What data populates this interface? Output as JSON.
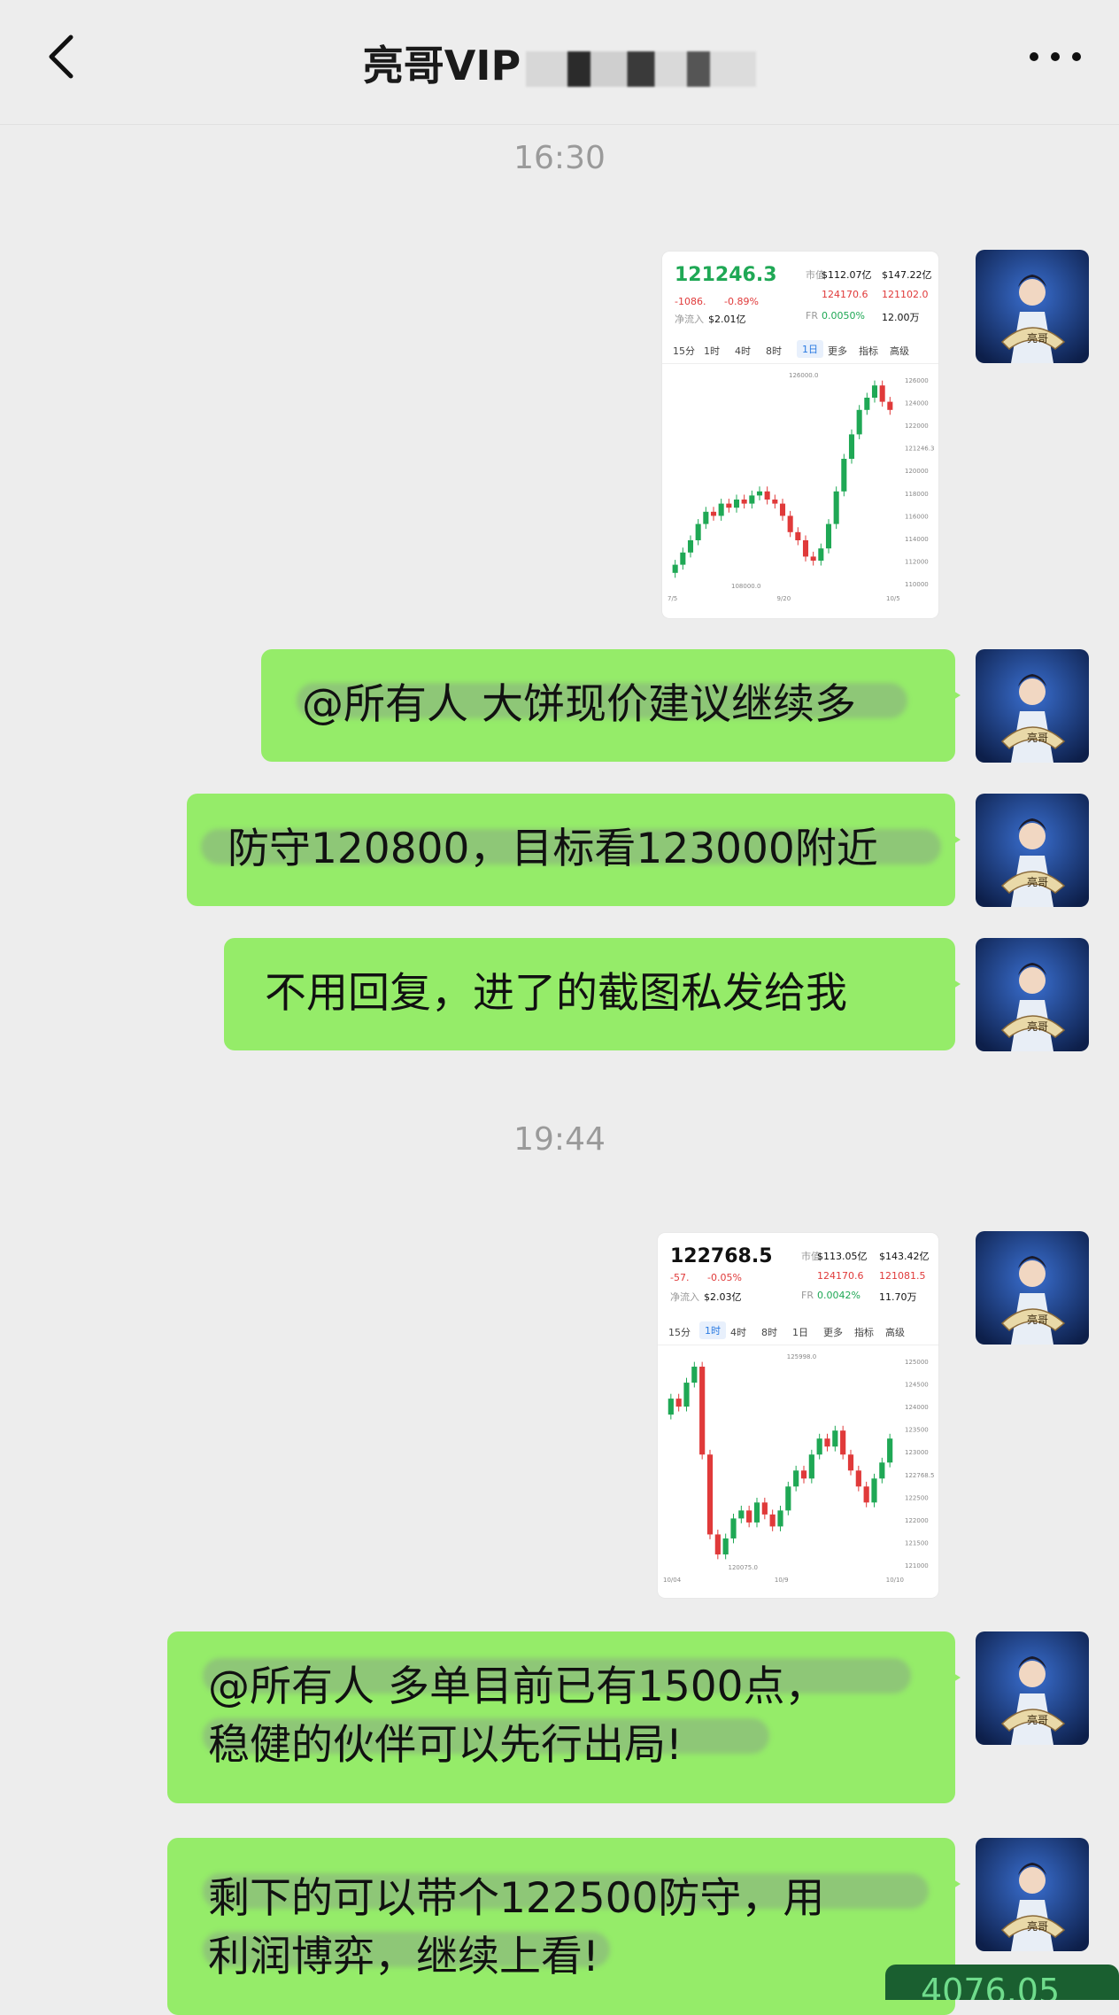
{
  "header": {
    "title_visible": "亮哥VIP",
    "back_icon": "chevron-left-icon",
    "more_icon": "more-dots-icon"
  },
  "timestamps": [
    "16:30",
    "19:44"
  ],
  "messages": [
    {
      "type": "image",
      "desc": "k-line screenshot 1"
    },
    {
      "type": "text",
      "text": "@所有人 大饼现价建议继续多"
    },
    {
      "type": "text",
      "text": "防守120800，目标看123000附近"
    },
    {
      "type": "text",
      "text": "不用回复，进了的截图私发给我"
    },
    {
      "type": "image",
      "desc": "k-line screenshot 2"
    },
    {
      "type": "text",
      "text": "@所有人 多单目前已有1500点，\n稳健的伙伴可以先行出局!"
    },
    {
      "type": "text",
      "text": "剩下的可以带个122500防守，用\n利润博弈，继续上看!"
    }
  ],
  "shot1": {
    "price": "121246.3",
    "change": "-1086.",
    "change_pct": "-0.89%",
    "net_label": "净流入",
    "net_value": "$2.01亿",
    "cap_label": "市值",
    "cap_value": "$112.07亿",
    "vol_value": "$147.22亿",
    "high": "124170.6",
    "low": "121102.0",
    "fr_label": "FR",
    "fr_value": "0.0050%",
    "count_value": "12.00万",
    "tabs": [
      "15分",
      "1时",
      "4时",
      "8时",
      "1日",
      "更多",
      "指标",
      "高级"
    ],
    "active_tab": 4,
    "y_ticks": [
      "126000",
      "124000",
      "122000",
      "121246.3",
      "120000",
      "118000",
      "116000",
      "114000",
      "112000",
      "110000"
    ],
    "x_ticks": [
      "7/5",
      "9/20",
      "10/5"
    ],
    "max_label": "126000.0",
    "min_label": "108000.0"
  },
  "shot2": {
    "price": "122768.5",
    "change": "-57.",
    "change_pct": "-0.05%",
    "net_label": "净流入",
    "net_value": "$2.03亿",
    "cap_label": "市值",
    "cap_value": "$113.05亿",
    "vol_value": "$143.42亿",
    "high": "124170.6",
    "low": "121081.5",
    "fr_label": "FR",
    "fr_value": "0.0042%",
    "count_value": "11.70万",
    "tabs": [
      "15分",
      "1时",
      "4时",
      "8时",
      "1日",
      "更多",
      "指标",
      "高级"
    ],
    "active_tab": 1,
    "y_ticks": [
      "125000",
      "124500",
      "124000",
      "123500",
      "123000",
      "122768.5",
      "122500",
      "122000",
      "121500",
      "121000"
    ],
    "x_ticks": [
      "10/04",
      "10/9",
      "10/10"
    ],
    "max_label": "125998.0",
    "min_label": "120075.0"
  },
  "bottom_badge": "4076.05",
  "colors": {
    "bubble": "#95ec69",
    "bg": "#ededed",
    "up": "#1fa855",
    "down": "#e03a3a"
  }
}
